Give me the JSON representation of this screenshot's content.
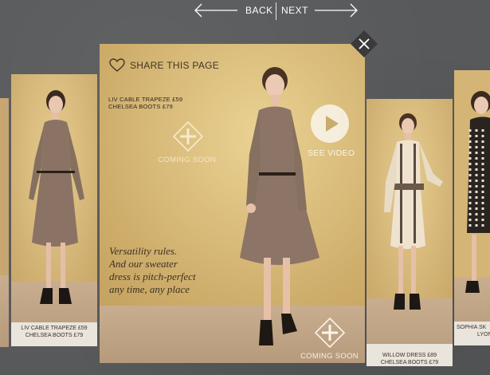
{
  "nav": {
    "back_label": "BACK",
    "next_label": "NEXT"
  },
  "main": {
    "share_label": "SHARE THIS PAGE",
    "product_line1": "LIV CABLE TRAPEZE £59",
    "product_line2": "CHELSEA BOOTS £79",
    "coming_soon_1": "COMING SOON",
    "coming_soon_2": "COMING SOON",
    "see_video_label": "SEE VIDEO",
    "quote_lines": [
      "Versatility rules.",
      "And our sweater",
      "dress is pitch-perfect",
      "any time, any place"
    ]
  },
  "left_panel": {
    "caption_line1": "LIV CABLE TRAPEZE £59",
    "caption_line2": "CHELSEA BOOTS £79"
  },
  "right_panel": {
    "caption_line1": "WILLOW DRESS £89",
    "caption_line2": "CHELSEA BOOTS £79"
  },
  "edge_panel": {
    "caption_line1": "SOPHIA SK",
    "caption_line2": "LYON L"
  },
  "icons": {
    "share": "heart-icon",
    "close": "close-icon",
    "play": "play-icon",
    "coming_soon": "plus-diamond-icon",
    "back": "arrow-left-icon",
    "next": "arrow-right-icon"
  },
  "colors": {
    "background": "#58595b",
    "wall": "#d9bb7c",
    "floor": "#c3a686",
    "dress": "#8a7364",
    "close_bg": "#3a3a3a"
  }
}
